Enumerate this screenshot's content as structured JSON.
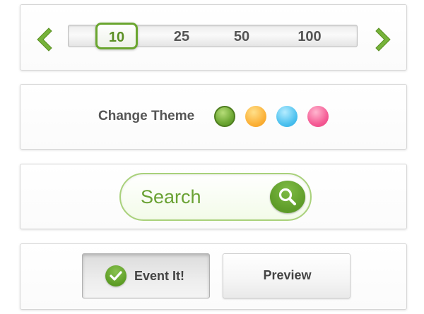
{
  "pager": {
    "prev_icon": "chevron-left-icon",
    "next_icon": "chevron-right-icon",
    "selected": "10",
    "options": [
      "10",
      "25",
      "50",
      "100"
    ],
    "accent_color": "#6aa62f"
  },
  "theme": {
    "label": "Change Theme",
    "swatches": [
      {
        "name": "green",
        "color": "#6ea834",
        "selected": true
      },
      {
        "name": "orange",
        "color": "#fbb23a",
        "selected": false
      },
      {
        "name": "blue",
        "color": "#4fc2ef",
        "selected": false
      },
      {
        "name": "pink",
        "color": "#f55d96",
        "selected": false
      }
    ]
  },
  "search": {
    "placeholder": "Search",
    "value": "",
    "button_icon": "magnifier-icon"
  },
  "actions": {
    "event_label": "Event It!",
    "event_icon": "checkmark-icon",
    "preview_label": "Preview"
  }
}
